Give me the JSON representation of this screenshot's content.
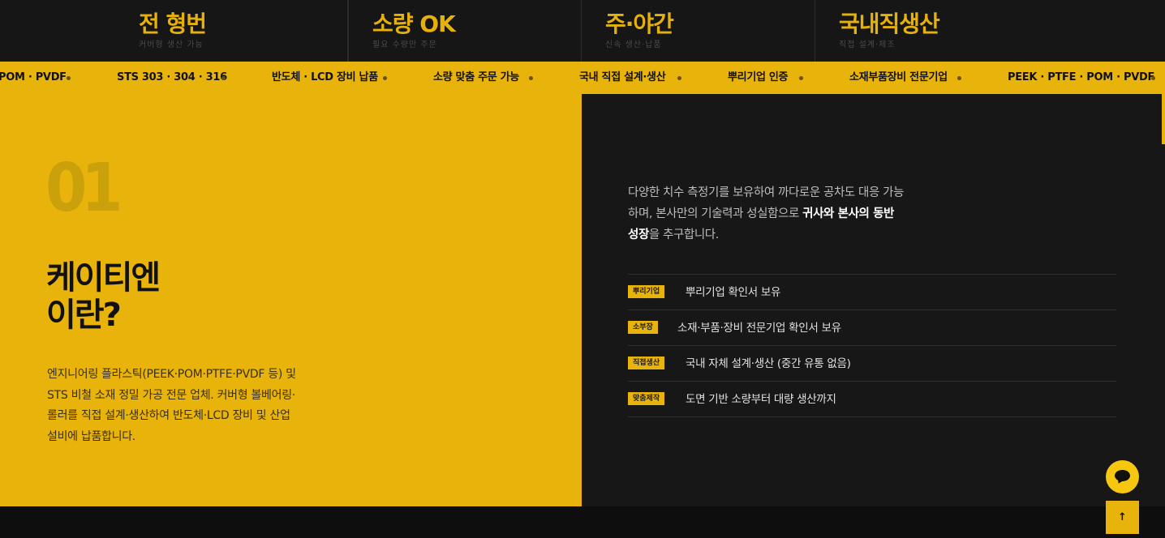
{
  "stats": [
    {
      "title": "전 형번",
      "sub": "커버형 생산 가능"
    },
    {
      "title": "소량 OK",
      "sub": "필요 수량만 주문"
    },
    {
      "title": "주·야간",
      "sub": "신속 생산·납품"
    },
    {
      "title": "국내직생산",
      "sub": "직접 설계·제조"
    }
  ],
  "marquee": [
    "POM · PVDF",
    "STS 303 · 304 · 316",
    "반도체 · LCD 장비 납품",
    "소량 맞춤 주문 가능",
    "국내 직접 설계·생산",
    "뿌리기업 인증",
    "소재부품장비 전문기업",
    "PEEK · PTFE · POM · PVDF"
  ],
  "about": {
    "number": "01",
    "title_line1": "케이티엔",
    "title_line2": "이란?",
    "description": "엔지니어링 플라스틱(PEEK·POM·PTFE·PVDF 등) 및 STS 비철 소재 정밀 가공 전문 업체. 커버형 볼베어링·롤러를 직접 설계·생산하여 반도체·LCD 장비 및 산업 설비에 납품합니다."
  },
  "intro": {
    "text_before": "다양한 치수 측정기를 보유하여 까다로운 공차도 대응 가능하며, 본사만의 기술력과 성실함으로 ",
    "text_bold": "귀사와 본사의 동반 성장",
    "text_after": "을 추구합니다."
  },
  "features": [
    {
      "tag": "뿌리기업",
      "text": "뿌리기업 확인서 보유"
    },
    {
      "tag": "소부장",
      "text": "소재·부품·장비 전문기업 확인서 보유"
    },
    {
      "tag": "직접생산",
      "text": "국내 자체 설계·생산 (중간 유통 없음)"
    },
    {
      "tag": "맞춤제작",
      "text": "도면 기반 소량부터 대량 생산까지"
    }
  ],
  "floating": {
    "top_button_label": "↑"
  },
  "colors": {
    "accent": "#e8b30b",
    "dark": "#171717",
    "text_light": "#e2e2e2"
  }
}
